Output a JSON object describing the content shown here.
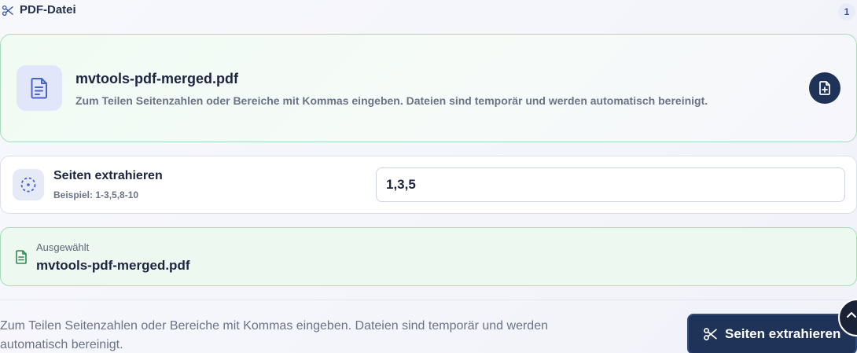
{
  "header": {
    "title": "PDF-Datei",
    "count": "1",
    "icon": "scissors-icon"
  },
  "file_card": {
    "filename": "mvtools-pdf-merged.pdf",
    "hint": "Zum Teilen Seitenzahlen oder Bereiche mit Kommas eingeben. Dateien sind temporär und werden automatisch bereinigt.",
    "icon": "document-icon",
    "action_icon": "replace-file-icon"
  },
  "range": {
    "label": "Seiten extrahieren",
    "example": "Beispiel: 1-3,5,8-10",
    "value": "1,3,5",
    "icon": "target-icon"
  },
  "selected": {
    "caption": "Ausgewählt",
    "filename": "mvtools-pdf-merged.pdf",
    "icon": "document-icon"
  },
  "footer": {
    "note": "Zum Teilen Seitenzahlen oder Bereiche mit Kommas eingeben. Dateien sind temporär und werden automatisch bereinigt.",
    "submit_label": "Seiten extrahieren",
    "submit_icon": "scissors-icon",
    "scroll_icon": "chevron-up-icon"
  },
  "colors": {
    "accent": "#1f3358",
    "success_border": "#a8dcb6",
    "success_bg": "#edf8f0"
  }
}
